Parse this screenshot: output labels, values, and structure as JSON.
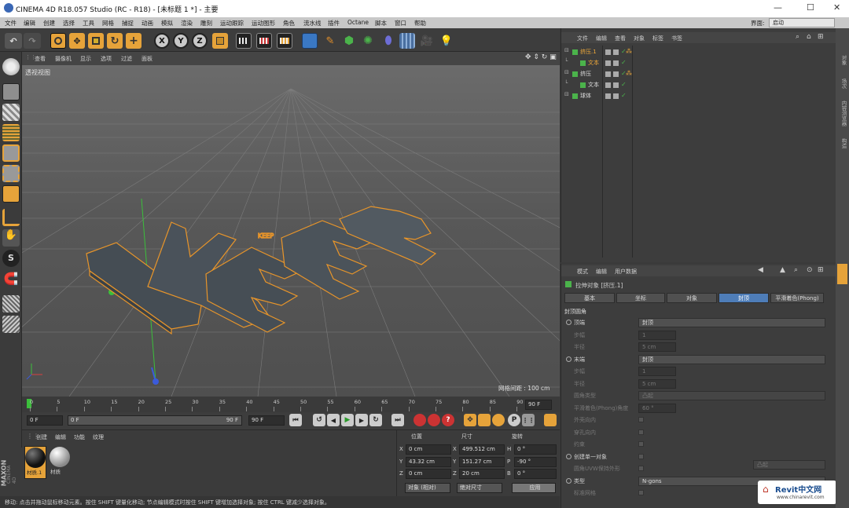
{
  "window": {
    "title": "CINEMA 4D R18.057 Studio (RC - R18) - [未标题 1 *] - 主要"
  },
  "menu": {
    "items": [
      "文件",
      "编辑",
      "创建",
      "选择",
      "工具",
      "网格",
      "捕捉",
      "动画",
      "模拟",
      "渲染",
      "雕刻",
      "运动跟踪",
      "运动图形",
      "角色",
      "流水线",
      "插件",
      "Octane",
      "脚本",
      "窗口",
      "帮助"
    ],
    "layout_label": "界面:",
    "layout_value": "启动"
  },
  "toolbar": {
    "axis_x": "X",
    "axis_y": "Y",
    "axis_z": "Z"
  },
  "viewport": {
    "menu": [
      "查看",
      "摄像机",
      "显示",
      "选项",
      "过滤",
      "面板"
    ],
    "label": "透视视图",
    "grid_info": "网格间距 : 100 cm",
    "text_3d": "KEEP"
  },
  "timeline": {
    "ticks": [
      "0",
      "5",
      "10",
      "15",
      "20",
      "25",
      "30",
      "35",
      "40",
      "45",
      "50",
      "55",
      "60",
      "65",
      "70",
      "75",
      "80",
      "85",
      "90"
    ],
    "end_frame": "90 F"
  },
  "transport": {
    "current_frame": "0 F",
    "range_start": "0 F",
    "range_end": "90 F",
    "max_frame": "90 F"
  },
  "materials": {
    "menu": [
      "创建",
      "编辑",
      "功能",
      "纹理"
    ],
    "items": [
      {
        "name": "材质.1"
      },
      {
        "name": "材质"
      }
    ],
    "brand_top": "MAXON",
    "brand_bottom": "CINEMA 4D"
  },
  "coords": {
    "headers": [
      "位置",
      "尺寸",
      "旋转"
    ],
    "rows": [
      {
        "axis": "X",
        "pos": "0 cm",
        "size_axis": "X",
        "size": "499.512 cm",
        "rot_axis": "H",
        "rot": "0 °"
      },
      {
        "axis": "Y",
        "pos": "43.32 cm",
        "size_axis": "Y",
        "size": "151.27 cm",
        "rot_axis": "P",
        "rot": "-90 °"
      },
      {
        "axis": "Z",
        "pos": "0 cm",
        "size_axis": "Z",
        "size": "20 cm",
        "rot_axis": "B",
        "rot": "0 °"
      }
    ],
    "mode": "对象 (相对)",
    "size_mode": "绝对尺寸",
    "apply": "应用"
  },
  "status": {
    "text": "移动: 点击并拖动鼠标移动元素。按住 SHIFT 键量化移动; 节点编辑模式时按住 SHIFT 键增加选择对象; 按住 CTRL 键减少选择对象。"
  },
  "object_manager": {
    "menu": [
      "文件",
      "编辑",
      "查看",
      "对象",
      "标签",
      "书签"
    ],
    "objects": [
      {
        "name": "挤压.1",
        "indent": 0,
        "selected": true
      },
      {
        "name": "文本",
        "indent": 1,
        "selected": true
      },
      {
        "name": "挤压",
        "indent": 0,
        "selected": false
      },
      {
        "name": "文本",
        "indent": 1,
        "selected": false
      },
      {
        "name": "球体",
        "indent": 0,
        "selected": false
      }
    ]
  },
  "attributes": {
    "menu": [
      "模式",
      "编辑",
      "用户数据"
    ],
    "title": "拉伸对象 [挤压.1]",
    "tabs": [
      "基本",
      "坐标",
      "对象",
      "封顶",
      "平滑着色(Phong)"
    ],
    "active_tab": "封顶",
    "section": "封顶圆角",
    "rows": [
      {
        "label": "顶端",
        "type": "dropdown",
        "value": "封顶",
        "radio": true,
        "dim": false
      },
      {
        "label": "步幅",
        "type": "number",
        "value": "1",
        "radio": false,
        "dim": true
      },
      {
        "label": "半径",
        "type": "number",
        "value": "5 cm",
        "radio": false,
        "dim": true
      },
      {
        "label": "末端",
        "type": "dropdown",
        "value": "封顶",
        "radio": true,
        "dim": false
      },
      {
        "label": "步幅",
        "type": "number",
        "value": "1",
        "radio": false,
        "dim": true
      },
      {
        "label": "半径",
        "type": "number",
        "value": "5 cm",
        "radio": false,
        "dim": true
      },
      {
        "label": "圆角类型",
        "type": "dropdown",
        "value": "凸起",
        "radio": false,
        "dim": true
      },
      {
        "label": "平滑着色(Phong)角度",
        "type": "number",
        "value": "60 °",
        "radio": false,
        "dim": true
      },
      {
        "label": "外壳向内",
        "type": "check",
        "value": "",
        "radio": false,
        "dim": true
      },
      {
        "label": "穿孔向内",
        "type": "check",
        "value": "",
        "radio": false,
        "dim": true
      },
      {
        "label": "约束",
        "type": "check",
        "value": "",
        "radio": false,
        "dim": true
      },
      {
        "label": "创建单一对象",
        "type": "check",
        "value": "",
        "radio": true,
        "dim": false
      },
      {
        "label": "圆角UVW保持外形",
        "type": "check",
        "value": "",
        "radio": false,
        "dim": true
      },
      {
        "label": "类型",
        "type": "dropdown",
        "value": "N-gons",
        "radio": true,
        "dim": false
      },
      {
        "label": "标准网格",
        "type": "check",
        "value": "",
        "radio": false,
        "dim": true
      }
    ],
    "aux_value": "凸起"
  },
  "sidetabs": [
    "对象",
    "场次",
    "内容浏览器",
    "构造"
  ],
  "watermark": {
    "brand": "Revit中文网",
    "url": "www.chinarevit.com"
  }
}
